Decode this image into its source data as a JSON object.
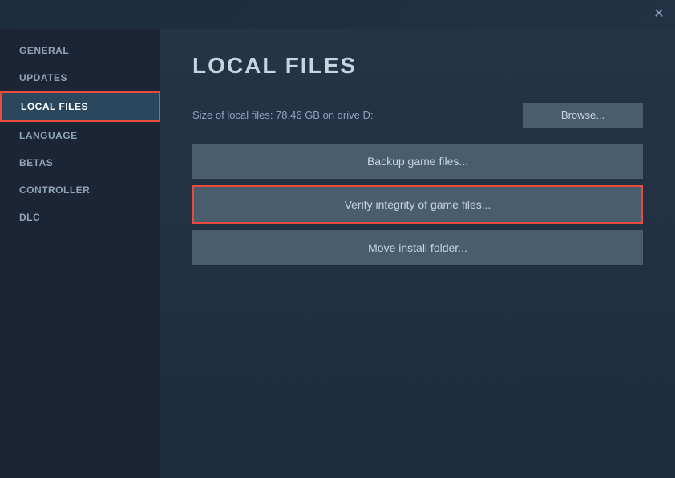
{
  "dialog": {
    "title": "LOCAL FILES"
  },
  "sidebar": {
    "items": [
      {
        "id": "general",
        "label": "GENERAL",
        "active": false
      },
      {
        "id": "updates",
        "label": "UPDATES",
        "active": false
      },
      {
        "id": "local-files",
        "label": "LOCAL FILES",
        "active": true
      },
      {
        "id": "language",
        "label": "LANGUAGE",
        "active": false
      },
      {
        "id": "betas",
        "label": "BETAS",
        "active": false
      },
      {
        "id": "controller",
        "label": "CONTROLLER",
        "active": false
      },
      {
        "id": "dlc",
        "label": "DLC",
        "active": false
      }
    ]
  },
  "main": {
    "file_size_label": "Size of local files: 78.46 GB on drive D:",
    "browse_button": "Browse...",
    "backup_button": "Backup game files...",
    "verify_button": "Verify integrity of game files...",
    "move_button": "Move install folder..."
  },
  "close_icon": "✕"
}
